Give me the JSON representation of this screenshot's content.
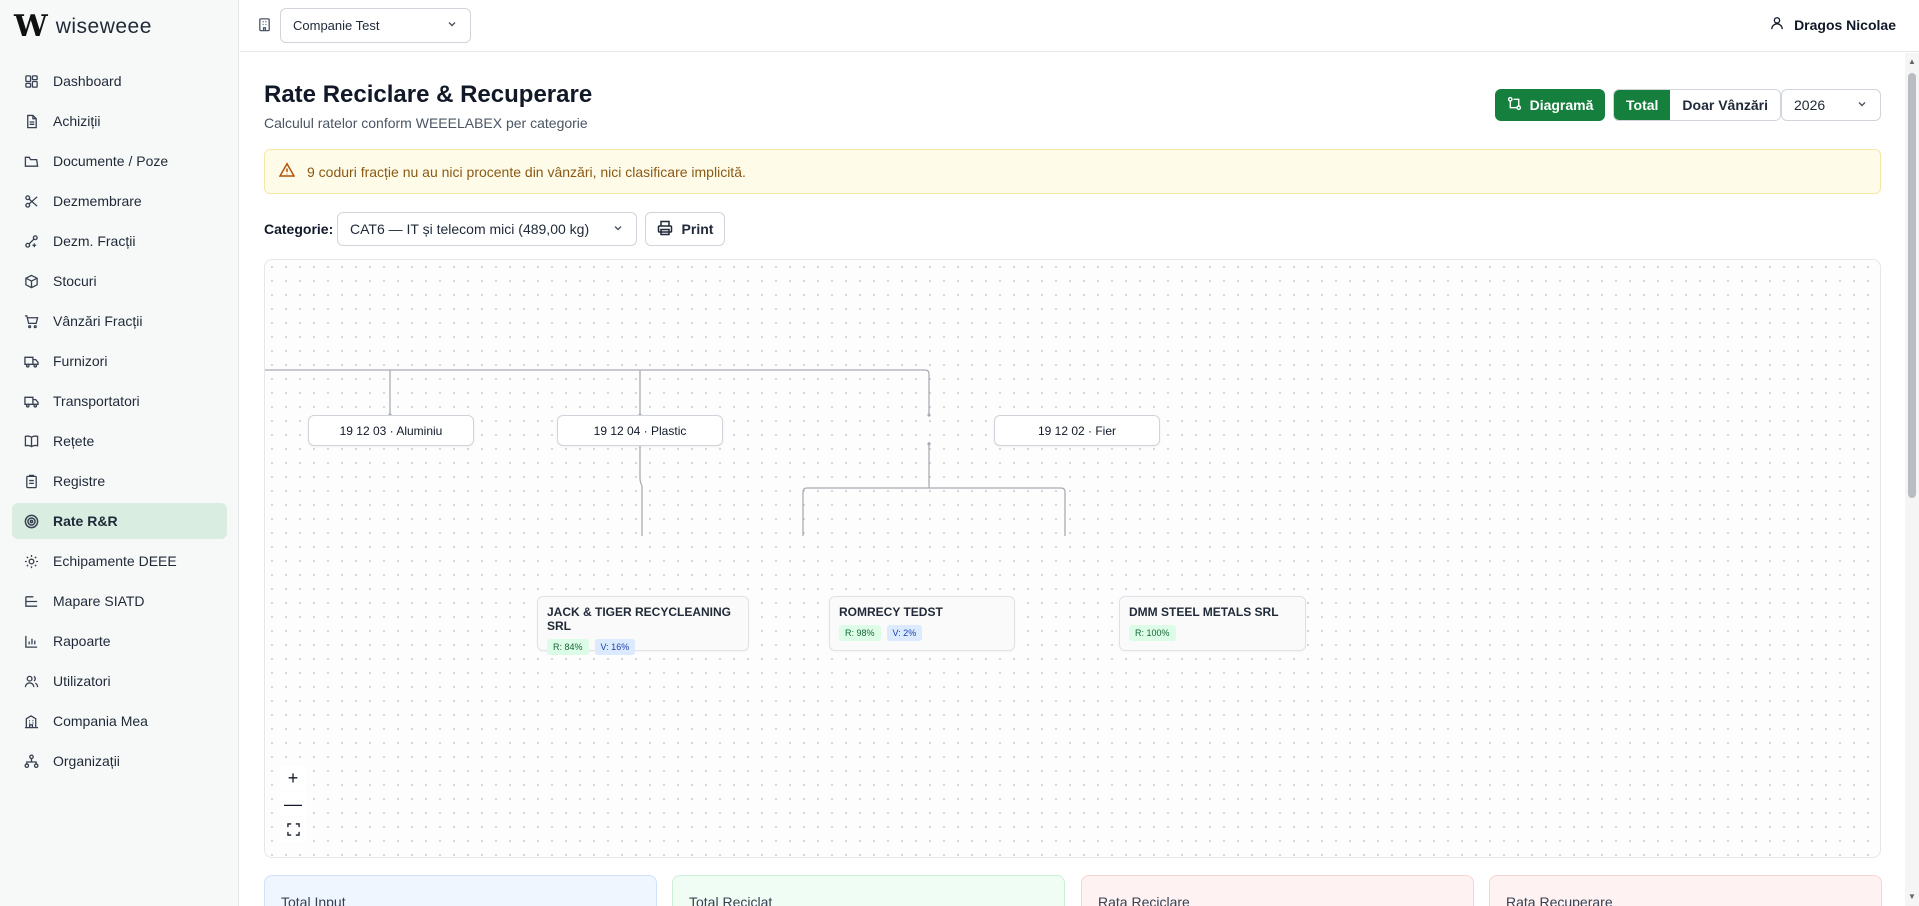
{
  "app": {
    "logo_mark": "W",
    "logo_text": "wiseweee"
  },
  "sidebar": {
    "items": [
      {
        "label": "Dashboard",
        "icon": "dashboard-icon"
      },
      {
        "label": "Achiziții",
        "icon": "file-icon"
      },
      {
        "label": "Documente / Poze",
        "icon": "folder-icon"
      },
      {
        "label": "Dezmembrare",
        "icon": "scissors-icon"
      },
      {
        "label": "Dezm. Fracții",
        "icon": "split-icon"
      },
      {
        "label": "Stocuri",
        "icon": "package-icon"
      },
      {
        "label": "Vânzări Fracții",
        "icon": "cart-icon"
      },
      {
        "label": "Furnizori",
        "icon": "truck-icon"
      },
      {
        "label": "Transportatori",
        "icon": "truck-icon"
      },
      {
        "label": "Rețete",
        "icon": "book-icon"
      },
      {
        "label": "Registre",
        "icon": "clipboard-icon"
      },
      {
        "label": "Rate R&R",
        "icon": "target-icon",
        "active": true
      },
      {
        "label": "Echipamente DEEE",
        "icon": "cog-icon"
      },
      {
        "label": "Mapare SIATD",
        "icon": "list-tree-icon"
      },
      {
        "label": "Rapoarte",
        "icon": "bar-chart-icon"
      },
      {
        "label": "Utilizatori",
        "icon": "users-icon"
      },
      {
        "label": "Compania Mea",
        "icon": "building-icon"
      },
      {
        "label": "Organizații",
        "icon": "network-icon"
      }
    ]
  },
  "topbar": {
    "company": "Companie Test",
    "user": "Dragos Nicolae"
  },
  "page": {
    "title": "Rate Reciclare & Recuperare",
    "subtitle": "Calculul ratelor conform WEEELABEX per categorie",
    "diagram_button": "Diagramă",
    "toggle_total": "Total",
    "toggle_sales": "Doar Vânzări",
    "year": "2026",
    "alert": "9 coduri fracție nu au nici procente din vânzări, nici clasificare implicită.",
    "category_label": "Categorie:",
    "category_value": "CAT6 — IT și telecom mici (489,00 kg)",
    "print_label": "Print"
  },
  "diagram": {
    "fractions": [
      {
        "label": "19 12 03 · Aluminiu"
      },
      {
        "label": "19 12 04 · Plastic"
      },
      {
        "label": "19 12 02 · Fier"
      }
    ],
    "buyers": [
      {
        "name": "JACK & TIGER RECYCLEANING SRL",
        "r": "R: 84%",
        "v": "V: 16%"
      },
      {
        "name": "ROMRECY TEDST",
        "r": "R: 98%",
        "v": "V: 2%"
      },
      {
        "name": "DMM STEEL METALS SRL",
        "r": "R: 100%"
      }
    ],
    "zoom_in": "+",
    "zoom_out": "—"
  },
  "cards": [
    {
      "label": "Total Input"
    },
    {
      "label": "Total Reciclat"
    },
    {
      "label": "Rata Reciclare"
    },
    {
      "label": "Rata Recuperare"
    }
  ],
  "colors": {
    "accent": "#15803d",
    "active_nav": "#d9ede1",
    "alert_bg": "#fefbe8",
    "alert_text": "#8a5a14"
  }
}
